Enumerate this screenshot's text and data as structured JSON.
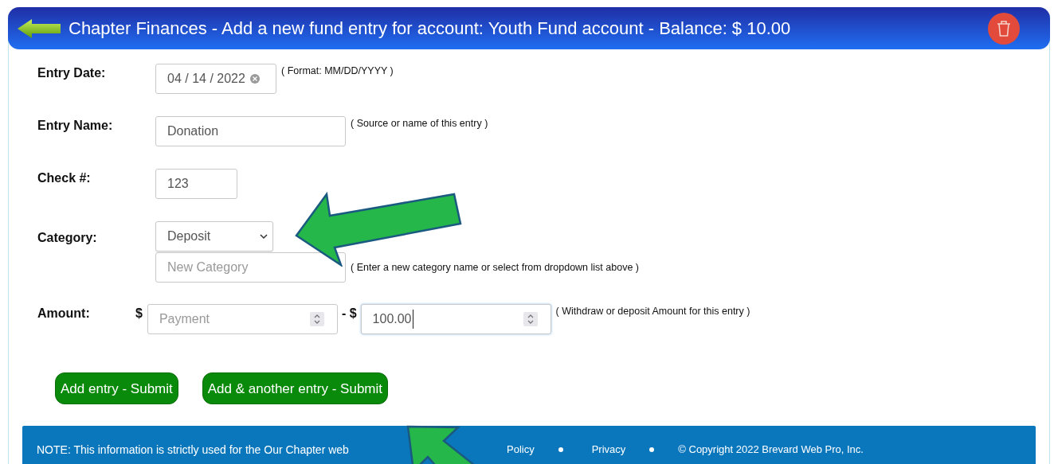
{
  "header": {
    "title": "Chapter Finances - Add a new fund entry for account: Youth Fund account - Balance: $ 10.00"
  },
  "fields": [
    {
      "kind": "date",
      "label": "Entry Date:",
      "value": "04 / 14 / 2022",
      "hint": "( Format: MM/DD/YYYY )"
    },
    {
      "kind": "text",
      "label": "Entry Name:",
      "value": "Donation",
      "hint": "( Source or name of this entry )"
    },
    {
      "kind": "short",
      "label": "Check #:",
      "value": "123"
    },
    {
      "kind": "category",
      "label": "Category:",
      "value": "Deposit",
      "placeholder": "New Category",
      "hint": "( Enter a new category name or select from dropdown list above )"
    },
    {
      "kind": "amount",
      "label": "Amount:",
      "prefix": "$",
      "placeholder": "Payment",
      "separator": "- $",
      "value": "100.00",
      "hint": "( Withdraw or deposit Amount for this entry )",
      "focused": true
    }
  ],
  "buttons": [
    "Add entry - Submit",
    "Add & another entry - Submit"
  ],
  "footer": {
    "note": "NOTE: This information is strictly used for the Our Chapter web",
    "links": [
      "Policy",
      "Privacy"
    ],
    "copyright": "© Copyright 2022 Brevard Web Pro, Inc."
  }
}
